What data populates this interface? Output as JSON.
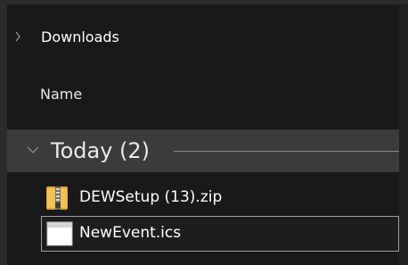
{
  "breadcrumb": {
    "items": [
      {
        "label": "Downloads"
      }
    ]
  },
  "file_list": {
    "column_header": "Name",
    "groups": [
      {
        "title": "Today (2)",
        "expanded": true,
        "files": [
          {
            "name": "DEWSetup (13).zip",
            "icon": "zip-folder-icon",
            "selected": false
          },
          {
            "name": "NewEvent.ics",
            "icon": "calendar-file-icon",
            "selected": true
          }
        ]
      }
    ]
  },
  "colors": {
    "background": "#191919",
    "group_header": "#3b3b3b",
    "selection_border": "#9e9e9e",
    "zip_accent": "#f2c24d"
  }
}
